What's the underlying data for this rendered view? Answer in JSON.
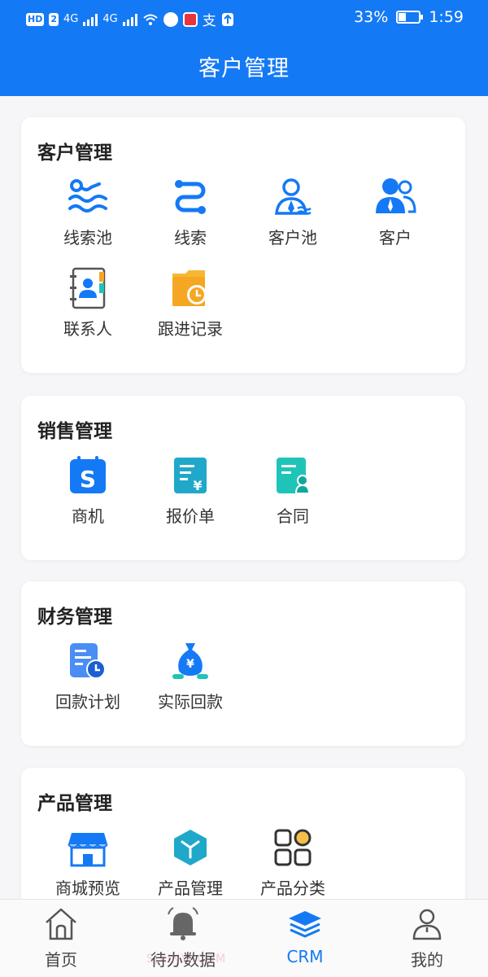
{
  "statusbar": {
    "chip1": "HD",
    "chip2": "2",
    "net1": "4G",
    "net2": "4G",
    "pay": "支",
    "battery": "33%",
    "battery_level": 0.33,
    "time": "1:59"
  },
  "header": {
    "title": "客户管理"
  },
  "sections": [
    {
      "title": "客户管理",
      "items": [
        {
          "label": "线索池",
          "icon": "waves-icon"
        },
        {
          "label": "线索",
          "icon": "route-icon"
        },
        {
          "label": "客户池",
          "icon": "user-pool-icon"
        },
        {
          "label": "客户",
          "icon": "users-icon"
        },
        {
          "label": "联系人",
          "icon": "address-book-icon"
        },
        {
          "label": "跟进记录",
          "icon": "folder-clock-icon"
        }
      ]
    },
    {
      "title": "销售管理",
      "items": [
        {
          "label": "商机",
          "icon": "calendar-s-icon"
        },
        {
          "label": "报价单",
          "icon": "quote-icon"
        },
        {
          "label": "合同",
          "icon": "contract-icon"
        }
      ]
    },
    {
      "title": "财务管理",
      "items": [
        {
          "label": "回款计划",
          "icon": "payment-plan-icon"
        },
        {
          "label": "实际回款",
          "icon": "money-bag-icon"
        }
      ]
    },
    {
      "title": "产品管理",
      "items": [
        {
          "label": "商城预览",
          "icon": "shop-icon"
        },
        {
          "label": "产品管理",
          "icon": "cube-icon"
        },
        {
          "label": "产品分类",
          "icon": "category-icon"
        }
      ]
    }
  ],
  "tabbar": [
    {
      "label": "首页",
      "icon": "home-icon"
    },
    {
      "label": "待办数据",
      "icon": "bell-icon"
    },
    {
      "label": "CRM",
      "icon": "layers-icon",
      "active": true
    },
    {
      "label": "我的",
      "icon": "profile-icon"
    }
  ],
  "watermark": "SJXINYI.COM",
  "colors": {
    "primary": "#1479f5",
    "orange": "#f5a623",
    "teal": "#1fc4b8",
    "text": "#333333"
  }
}
